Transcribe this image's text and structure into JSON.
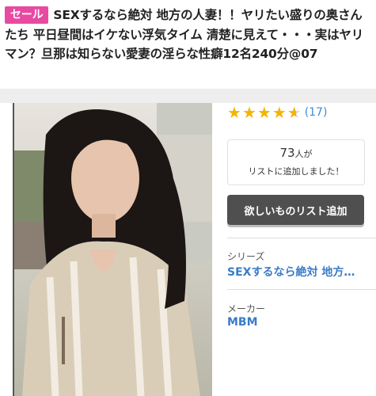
{
  "badge": "セール",
  "title": "SEXするなら絶対 地方の人妻！！ヤリたい盛りの奥さんたち 平日昼間はイケない浮気タイム 清楚に見えて・・・実はヤリマン？旦那は知らない愛妻の淫らな性癖12名240分@07",
  "rating": {
    "stars": 4.5,
    "max": 5,
    "review_count": "(17)"
  },
  "wishlist": {
    "count": "73",
    "unit": "人が",
    "message": "リストに追加しました！",
    "button_label": "欲しいものリスト追加"
  },
  "meta": {
    "series_label": "シリーズ",
    "series_value": "SEXするなら絶対 地方…",
    "maker_label": "メーカー",
    "maker_value": "MBM"
  },
  "colors": {
    "badge": "#e84aa2",
    "star": "#f5b400",
    "link": "#3a7cc8",
    "button": "#4f4f4f"
  }
}
